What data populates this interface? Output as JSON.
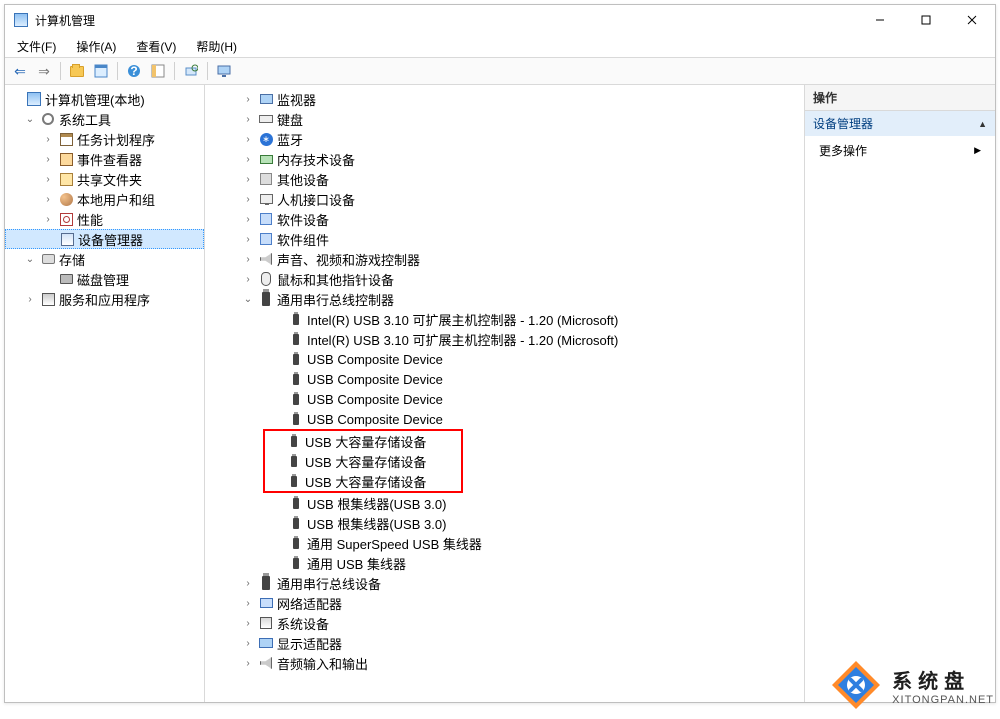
{
  "window": {
    "title": "计算机管理"
  },
  "menu": {
    "file": "文件(F)",
    "action": "操作(A)",
    "view": "查看(V)",
    "help": "帮助(H)"
  },
  "toolbar_icons": {
    "back": "nav-back-icon",
    "forward": "nav-forward-icon",
    "folder": "folder-icon",
    "props": "properties-icon",
    "help": "help-icon",
    "view1": "view-pane-icon",
    "view2": "view-pane2-icon",
    "refresh": "refresh-icon",
    "monitor": "monitor-icon"
  },
  "left_tree": [
    {
      "label": "计算机管理(本地)",
      "icon": "mgmt",
      "exp": "",
      "indent": 0
    },
    {
      "label": "系统工具",
      "icon": "gear",
      "exp": "v",
      "indent": 1
    },
    {
      "label": "任务计划程序",
      "icon": "calendar",
      "exp": ">",
      "indent": 2
    },
    {
      "label": "事件查看器",
      "icon": "event",
      "exp": ">",
      "indent": 2
    },
    {
      "label": "共享文件夹",
      "icon": "share",
      "exp": ">",
      "indent": 2
    },
    {
      "label": "本地用户和组",
      "icon": "users",
      "exp": ">",
      "indent": 2
    },
    {
      "label": "性能",
      "icon": "perf",
      "exp": ">",
      "indent": 2
    },
    {
      "label": "设备管理器",
      "icon": "device",
      "exp": "",
      "indent": 2,
      "selected": true
    },
    {
      "label": "存储",
      "icon": "storage",
      "exp": "v",
      "indent": 1
    },
    {
      "label": "磁盘管理",
      "icon": "disk",
      "exp": "",
      "indent": 2
    },
    {
      "label": "服务和应用程序",
      "icon": "service",
      "exp": ">",
      "indent": 1
    }
  ],
  "center_tree": [
    {
      "label": "监视器",
      "icon": "monitor",
      "exp": ">",
      "indent": 1
    },
    {
      "label": "键盘",
      "icon": "keyboard",
      "exp": ">",
      "indent": 1
    },
    {
      "label": "蓝牙",
      "icon": "bt",
      "exp": ">",
      "indent": 1
    },
    {
      "label": "内存技术设备",
      "icon": "mem",
      "exp": ">",
      "indent": 1
    },
    {
      "label": "其他设备",
      "icon": "other",
      "exp": ">",
      "indent": 1
    },
    {
      "label": "人机接口设备",
      "icon": "hid",
      "exp": ">",
      "indent": 1
    },
    {
      "label": "软件设备",
      "icon": "sw",
      "exp": ">",
      "indent": 1
    },
    {
      "label": "软件组件",
      "icon": "sw",
      "exp": ">",
      "indent": 1
    },
    {
      "label": "声音、视频和游戏控制器",
      "icon": "sound",
      "exp": ">",
      "indent": 1
    },
    {
      "label": "鼠标和其他指针设备",
      "icon": "mouse",
      "exp": ">",
      "indent": 1
    },
    {
      "label": "通用串行总线控制器",
      "icon": "usb",
      "exp": "v",
      "indent": 1
    },
    {
      "label": "Intel(R) USB 3.10 可扩展主机控制器 - 1.20 (Microsoft)",
      "icon": "usb-small",
      "exp": "",
      "indent": 2
    },
    {
      "label": "Intel(R) USB 3.10 可扩展主机控制器 - 1.20 (Microsoft)",
      "icon": "usb-small",
      "exp": "",
      "indent": 2
    },
    {
      "label": "USB Composite Device",
      "icon": "usb-small",
      "exp": "",
      "indent": 2
    },
    {
      "label": "USB Composite Device",
      "icon": "usb-small",
      "exp": "",
      "indent": 2
    },
    {
      "label": "USB Composite Device",
      "icon": "usb-small",
      "exp": "",
      "indent": 2
    },
    {
      "label": "USB Composite Device",
      "icon": "usb-small",
      "exp": "",
      "indent": 2
    },
    {
      "label": "USB 大容量存储设备",
      "icon": "usb-small",
      "exp": "",
      "indent": 2,
      "hl": true
    },
    {
      "label": "USB 大容量存储设备",
      "icon": "usb-small",
      "exp": "",
      "indent": 2,
      "hl": true
    },
    {
      "label": "USB 大容量存储设备",
      "icon": "usb-small",
      "exp": "",
      "indent": 2,
      "hl": true
    },
    {
      "label": "USB 根集线器(USB 3.0)",
      "icon": "usb-small",
      "exp": "",
      "indent": 2
    },
    {
      "label": "USB 根集线器(USB 3.0)",
      "icon": "usb-small",
      "exp": "",
      "indent": 2
    },
    {
      "label": "通用 SuperSpeed USB 集线器",
      "icon": "usb-small",
      "exp": "",
      "indent": 2
    },
    {
      "label": "通用 USB 集线器",
      "icon": "usb-small",
      "exp": "",
      "indent": 2
    },
    {
      "label": "通用串行总线设备",
      "icon": "usb",
      "exp": ">",
      "indent": 1
    },
    {
      "label": "网络适配器",
      "icon": "net",
      "exp": ">",
      "indent": 1
    },
    {
      "label": "系统设备",
      "icon": "sys",
      "exp": ">",
      "indent": 1
    },
    {
      "label": "显示适配器",
      "icon": "display",
      "exp": ">",
      "indent": 1
    },
    {
      "label": "音频输入和输出",
      "icon": "audio",
      "exp": ">",
      "indent": 1
    }
  ],
  "right_panel": {
    "header": "操作",
    "section": "设备管理器",
    "more": "更多操作"
  },
  "watermark": {
    "cn": "系统盘",
    "en": "XITONGPAN.NET"
  }
}
